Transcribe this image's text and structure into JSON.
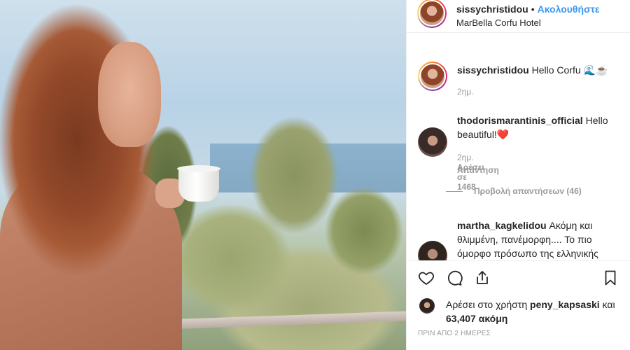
{
  "post": {
    "username": "sissychristidou",
    "separator": "•",
    "follow_label": "Ακολουθήστε",
    "location": "MarBella Corfu Hotel"
  },
  "caption": {
    "username": "sissychristidou",
    "text": "Hello Corfu",
    "emoji": "🌊☕",
    "time": "2ημ."
  },
  "comments": [
    {
      "username": "thodorismarantinis_official",
      "text": "Hello beautiful!❤️",
      "time": "2ημ.",
      "likes": "Αρέσει σε 1468",
      "reply_label": "Απάντηση"
    },
    {
      "username": "martha_kagkelidou",
      "text": "Ακόμη και θλιμμένη, πανέμορφη.... Το πιο όμορφο πρόσωπο της ελληνικής"
    }
  ],
  "view_replies": "Προβολή απαντήσεων (46)",
  "likes": {
    "prefix": "Αρέσει στο χρήστη",
    "user": "peny_kapsaski",
    "middle": "και",
    "count": "63,407 ακόμη"
  },
  "date": "ΠΡΙΝ ΑΠΟ 2 ΗΜΕΡΕΣ",
  "icons": [
    "heart-icon",
    "comment-icon",
    "share-icon",
    "bookmark-icon"
  ]
}
